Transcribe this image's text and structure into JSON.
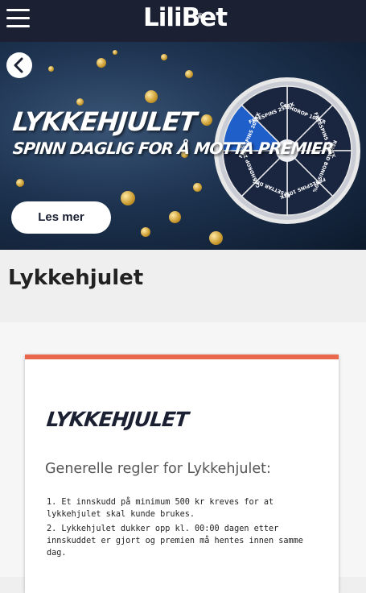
{
  "header": {
    "logo_text": "LiliBet",
    "menu_icon": "hamburger-icon"
  },
  "banner": {
    "back_icon": "chevron-left-icon",
    "title": "LYKKEHJULET",
    "subtitle": "SPINN DAGLIG FOR Å MOTTA PREMIER",
    "button_label": "Les mer",
    "wheel_segments": [
      "CASHDROP 100KR",
      "FREESPINS 50STK",
      "RELOAD BONUS 90%",
      "FREESPINS 10STK",
      "RESETTAR DEG",
      "CASHDROP 25KR",
      "FREESPINS 20STK",
      "FREESPINS 25STK"
    ]
  },
  "page": {
    "title": "Lykkehjulet"
  },
  "card": {
    "logo": "LYKKEHJULET",
    "heading": "Generelle regler for Lykkehjulet:",
    "rules": [
      "1. Et innskudd på minimum 500 kr kreves for at lykkehjulet skal kunde brukes.",
      "2. Lykkehjulet dukker opp kl. 00:00 dagen etter innskuddet er gjort og premien må hentes innen samme dag."
    ]
  },
  "colors": {
    "topbar": "#1b2033",
    "accent": "#e9684d",
    "wheel_blue": "#1f5fc9",
    "wheel_dark": "#1a2540"
  }
}
